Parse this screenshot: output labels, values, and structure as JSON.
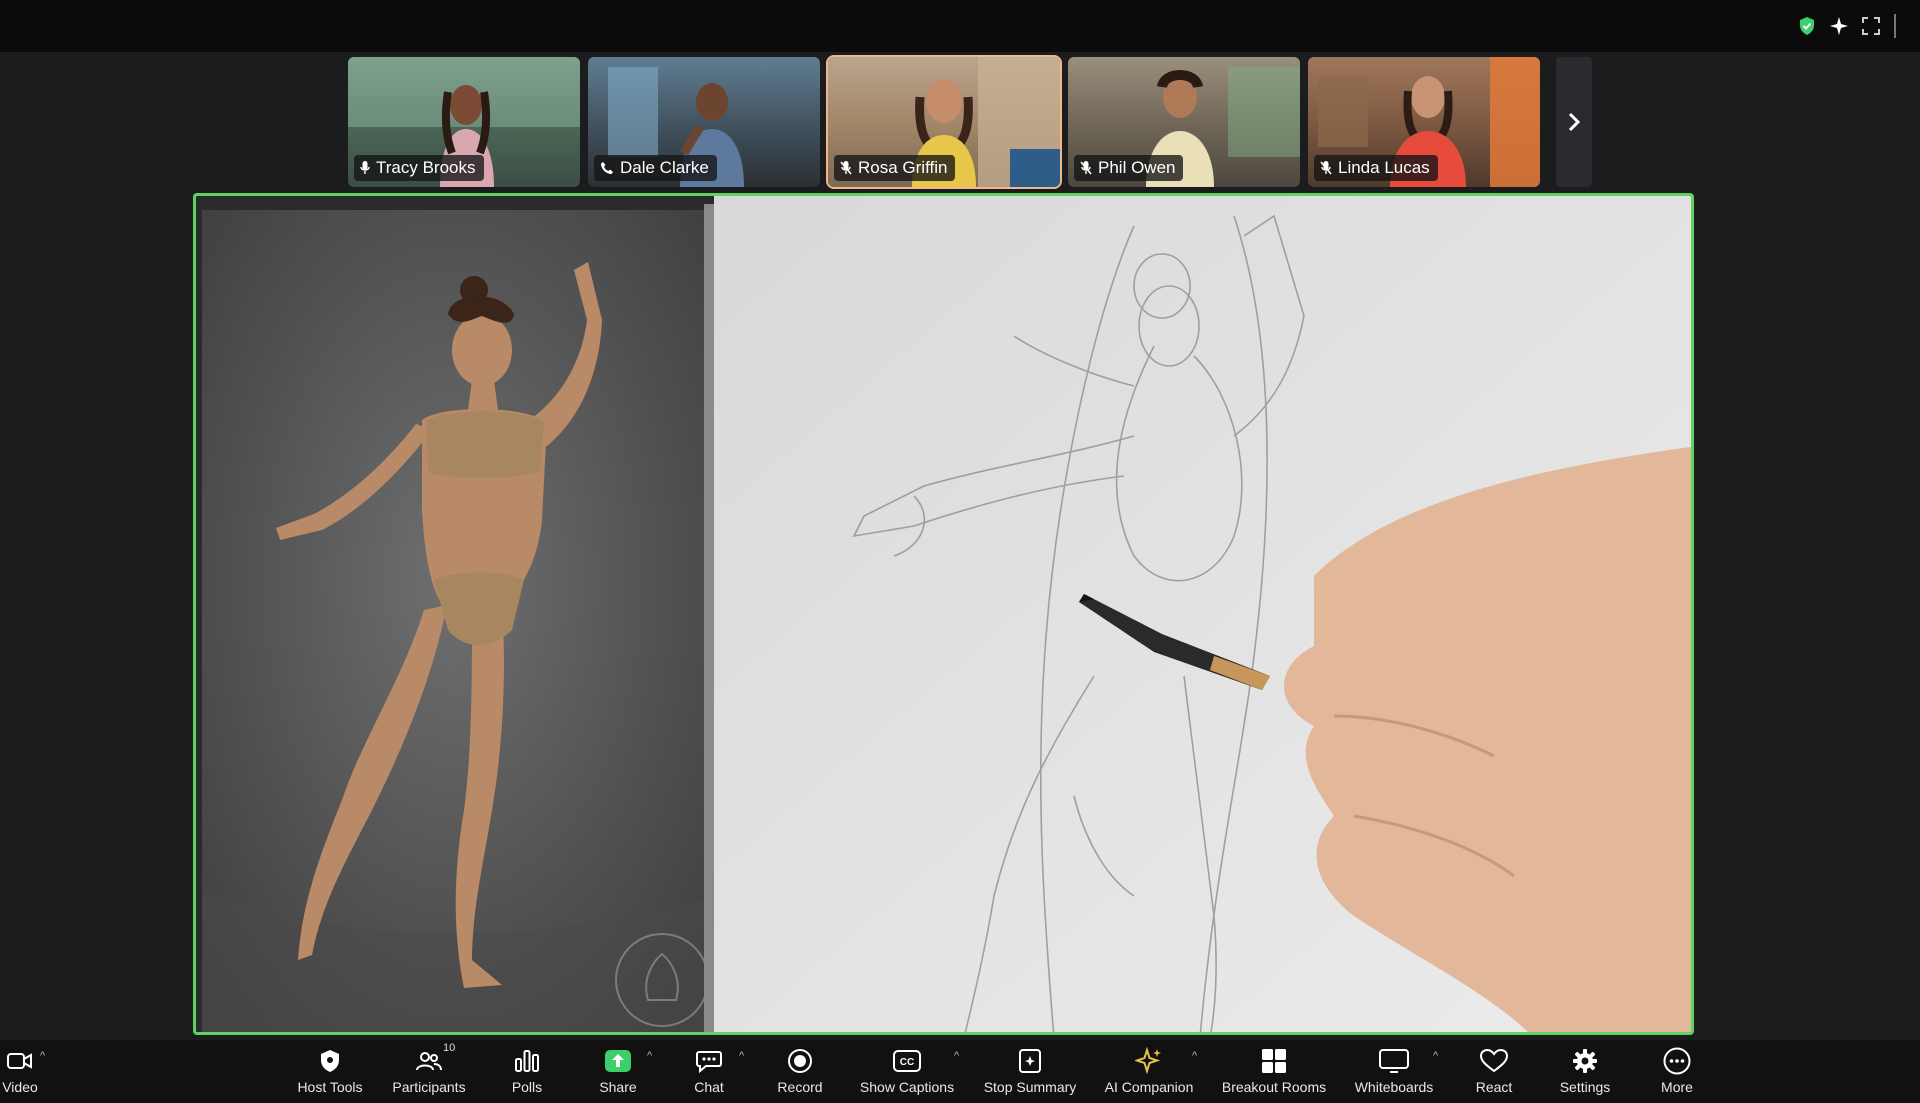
{
  "participants": [
    {
      "name": "Tracy Brooks",
      "mic": "mic-on",
      "active": false
    },
    {
      "name": "Dale Clarke",
      "mic": "phone",
      "active": false
    },
    {
      "name": "Rosa Griffin",
      "mic": "mic-muted",
      "active": true
    },
    {
      "name": "Phil Owen",
      "mic": "mic-muted",
      "active": false
    },
    {
      "name": "Linda Lucas",
      "mic": "mic-muted",
      "active": false
    }
  ],
  "toolbar": {
    "video": "Video",
    "host_tools": "Host Tools",
    "participants": "Participants",
    "participants_count": "10",
    "polls": "Polls",
    "share": "Share",
    "chat": "Chat",
    "record": "Record",
    "show_captions": "Show Captions",
    "stop_summary": "Stop Summary",
    "ai_companion": "AI Companion",
    "breakout_rooms": "Breakout Rooms",
    "whiteboards": "Whiteboards",
    "react": "React",
    "settings": "Settings",
    "more": "More"
  },
  "colors": {
    "share_border": "#5fd35f",
    "share_button": "#3ccf6b",
    "toolbar_bg": "#111111",
    "active_speaker": "#f0b88a"
  }
}
